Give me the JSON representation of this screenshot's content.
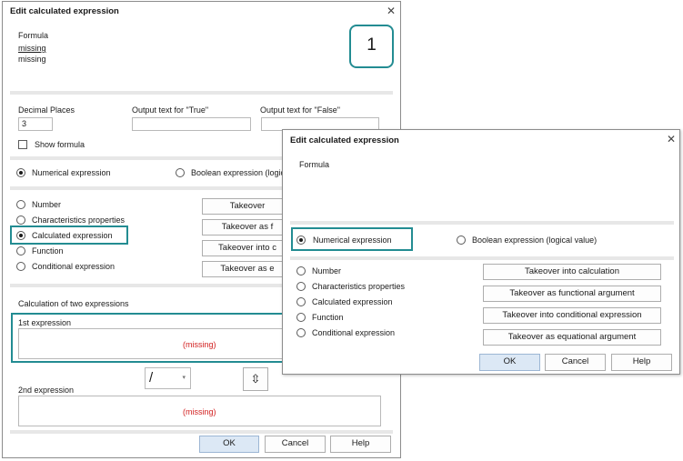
{
  "back": {
    "title": "Edit calculated expression",
    "formula_label": "Formula",
    "formula_line1": "missing",
    "formula_line2": "missing",
    "badge": "1",
    "decimal_label": "Decimal Places",
    "decimal_value": "3",
    "true_label": "Output text for \"True\"",
    "false_label": "Output text for \"False\"",
    "show_formula": "Show formula",
    "numerical": "Numerical expression",
    "boolean": "Boolean expression (logic",
    "types": [
      "Number",
      "Characteristics properties",
      "Calculated expression",
      "Function",
      "Conditional expression"
    ],
    "takeover": [
      "Takeover",
      "Takeover as f",
      "Takeover into c",
      "Takeover as e"
    ],
    "calc_label": "Calculation of two expressions",
    "first_label": "1st expression",
    "first_value": "(missing)",
    "operator": "/",
    "swap_icon": "up-down-arrow-icon",
    "second_label": "2nd expression",
    "second_value": "(missing)",
    "ok": "OK",
    "cancel": "Cancel",
    "help": "Help"
  },
  "front": {
    "title": "Edit calculated expression",
    "formula_label": "Formula",
    "numerical": "Numerical expression",
    "boolean": "Boolean expression (logical value)",
    "types": [
      "Number",
      "Characteristics properties",
      "Calculated expression",
      "Function",
      "Conditional expression"
    ],
    "takeover": [
      "Takeover into calculation",
      "Takeover as functional argument",
      "Takeover into conditional expression",
      "Takeover as equational argument"
    ],
    "ok": "OK",
    "cancel": "Cancel",
    "help": "Help"
  },
  "colors": {
    "highlight": "#238c92",
    "missing": "#d22020",
    "default_button": "#dce8f5"
  }
}
